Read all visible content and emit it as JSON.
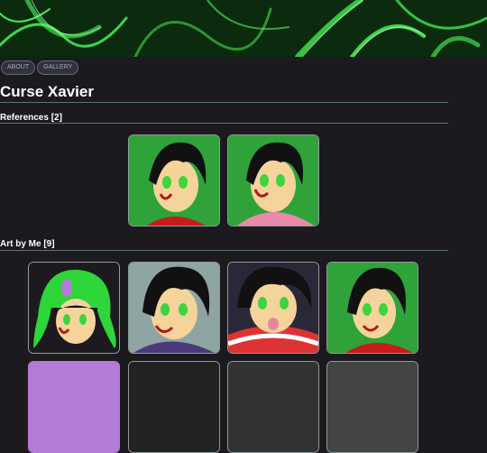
{
  "nav": {
    "about_label": "ABOUT",
    "gallery_label": "GALLERY"
  },
  "page": {
    "title": "Curse Xavier"
  },
  "sections": {
    "references": {
      "heading": "References [2]"
    },
    "art": {
      "heading": "Art by Me [9]"
    }
  },
  "colors": {
    "background": "#1c1a1f",
    "banner": "#0d2d10",
    "accent_green": "#39ff5a",
    "pill_bg": "#323040",
    "divider": "#5b7573"
  }
}
